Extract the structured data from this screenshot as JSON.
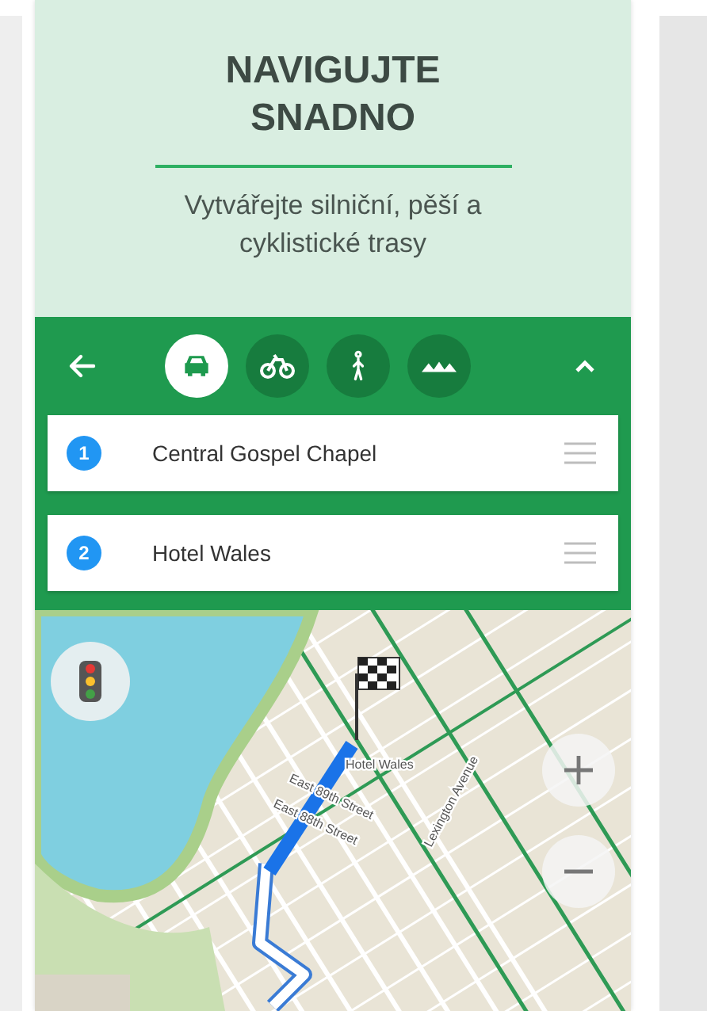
{
  "header": {
    "title": "NAVIGUJTE SNADNO",
    "subtitle": "Vytvářejte silniční, pěší a cyklistické trasy"
  },
  "toolbar": {
    "modes": [
      {
        "kind": "car",
        "selected": true
      },
      {
        "kind": "bike",
        "selected": false
      },
      {
        "kind": "walk",
        "selected": false
      },
      {
        "kind": "transit",
        "selected": false
      }
    ]
  },
  "waypoints": [
    {
      "number": "1",
      "name": "Central Gospel Chapel"
    },
    {
      "number": "2",
      "name": "Hotel Wales"
    }
  ],
  "map": {
    "labels": [
      {
        "kind": "poi",
        "text": "Hotel Wales"
      },
      {
        "kind": "street",
        "text": "East 89th Street"
      },
      {
        "kind": "street",
        "text": "East 88th Street"
      },
      {
        "kind": "avenue",
        "text": "Lexington Avenue"
      }
    ]
  }
}
